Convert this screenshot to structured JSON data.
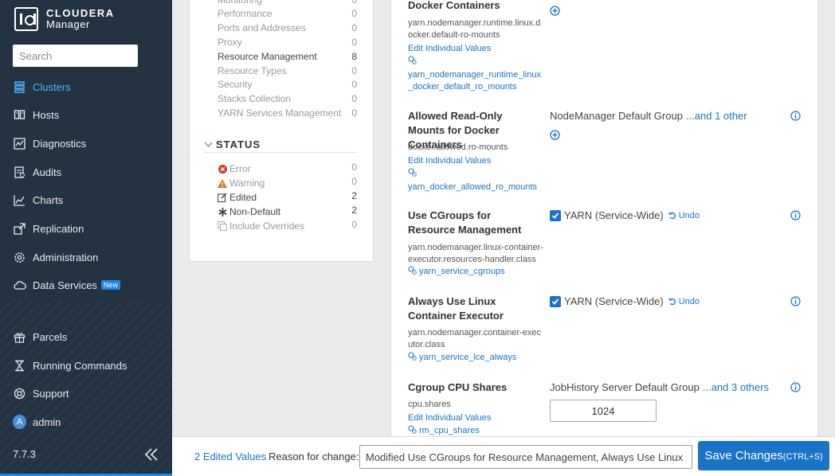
{
  "brand": {
    "name": "CLOUDERA",
    "product": "Manager"
  },
  "search": {
    "placeholder": "Search"
  },
  "nav": {
    "clusters": "Clusters",
    "hosts": "Hosts",
    "diagnostics": "Diagnostics",
    "audits": "Audits",
    "charts": "Charts",
    "replication": "Replication",
    "administration": "Administration",
    "data_services": "Data Services",
    "new_badge": "New",
    "parcels": "Parcels",
    "running_commands": "Running Commands",
    "support": "Support",
    "user": "admin",
    "user_initial": "A"
  },
  "version": "7.7.3",
  "filters": {
    "categories": [
      {
        "label": "Monitoring",
        "count": "0"
      },
      {
        "label": "Performance",
        "count": "0"
      },
      {
        "label": "Ports and Addresses",
        "count": "0"
      },
      {
        "label": "Proxy",
        "count": "0"
      },
      {
        "label": "Resource Management",
        "count": "8"
      },
      {
        "label": "Resource Types",
        "count": "0"
      },
      {
        "label": "Security",
        "count": "0"
      },
      {
        "label": "Stacks Collection",
        "count": "0"
      },
      {
        "label": "YARN Services Management",
        "count": "0"
      }
    ],
    "status_title": "STATUS",
    "status": [
      {
        "label": "Error",
        "count": "0"
      },
      {
        "label": "Warning",
        "count": "0"
      },
      {
        "label": "Edited",
        "count": "2"
      },
      {
        "label": "Non-Default",
        "count": "2"
      },
      {
        "label": "Include Overrides",
        "count": "0"
      }
    ]
  },
  "properties": {
    "p1": {
      "name": "Docker Containers",
      "key": "yarn.nodemanager.runtime.linux.docker.default-ro-mounts",
      "edit_link": "Edit Individual Values",
      "config": "yarn_nodemanager_runtime_linux_docker_default_ro_mounts"
    },
    "p2": {
      "name": "Allowed Read-Only Mounts for Docker Containers",
      "key": "docker.allowed.ro-mounts",
      "edit_link": "Edit Individual Values",
      "config": "yarn_docker_allowed_ro_mounts",
      "value": "NodeManager Default Group",
      "more": "...and 1 other"
    },
    "p3": {
      "name": "Use CGroups for Resource Management",
      "key": "yarn.nodemanager.linux-container-executor.resources-handler.class",
      "config": "yarn_service_cgroups",
      "value": "YARN (Service-Wide)",
      "undo": "Undo"
    },
    "p4": {
      "name": "Always Use Linux Container Executor",
      "key": "yarn.nodemanager.container-executor.class",
      "config": "yarn_service_lce_always",
      "value": "YARN (Service-Wide)",
      "undo": "Undo"
    },
    "p5": {
      "name": "Cgroup CPU Shares",
      "key": "cpu.shares",
      "edit_link": "Edit Individual Values",
      "config": "rm_cpu_shares",
      "value": "JobHistory Server Default Group",
      "more": "...and 3 others",
      "input_value": "1024"
    }
  },
  "footer": {
    "edited_values": "2 Edited Values",
    "reason_label": "Reason for change:",
    "reason_value": "Modified Use CGroups for Resource Management, Always Use Linux Container Executor",
    "save_label": "Save Changes",
    "save_shortcut": "(CTRL+S)"
  },
  "colors": {
    "sidebar_bg": "#243342",
    "accent": "#1a73c7",
    "active_nav": "#4fb3ff"
  }
}
